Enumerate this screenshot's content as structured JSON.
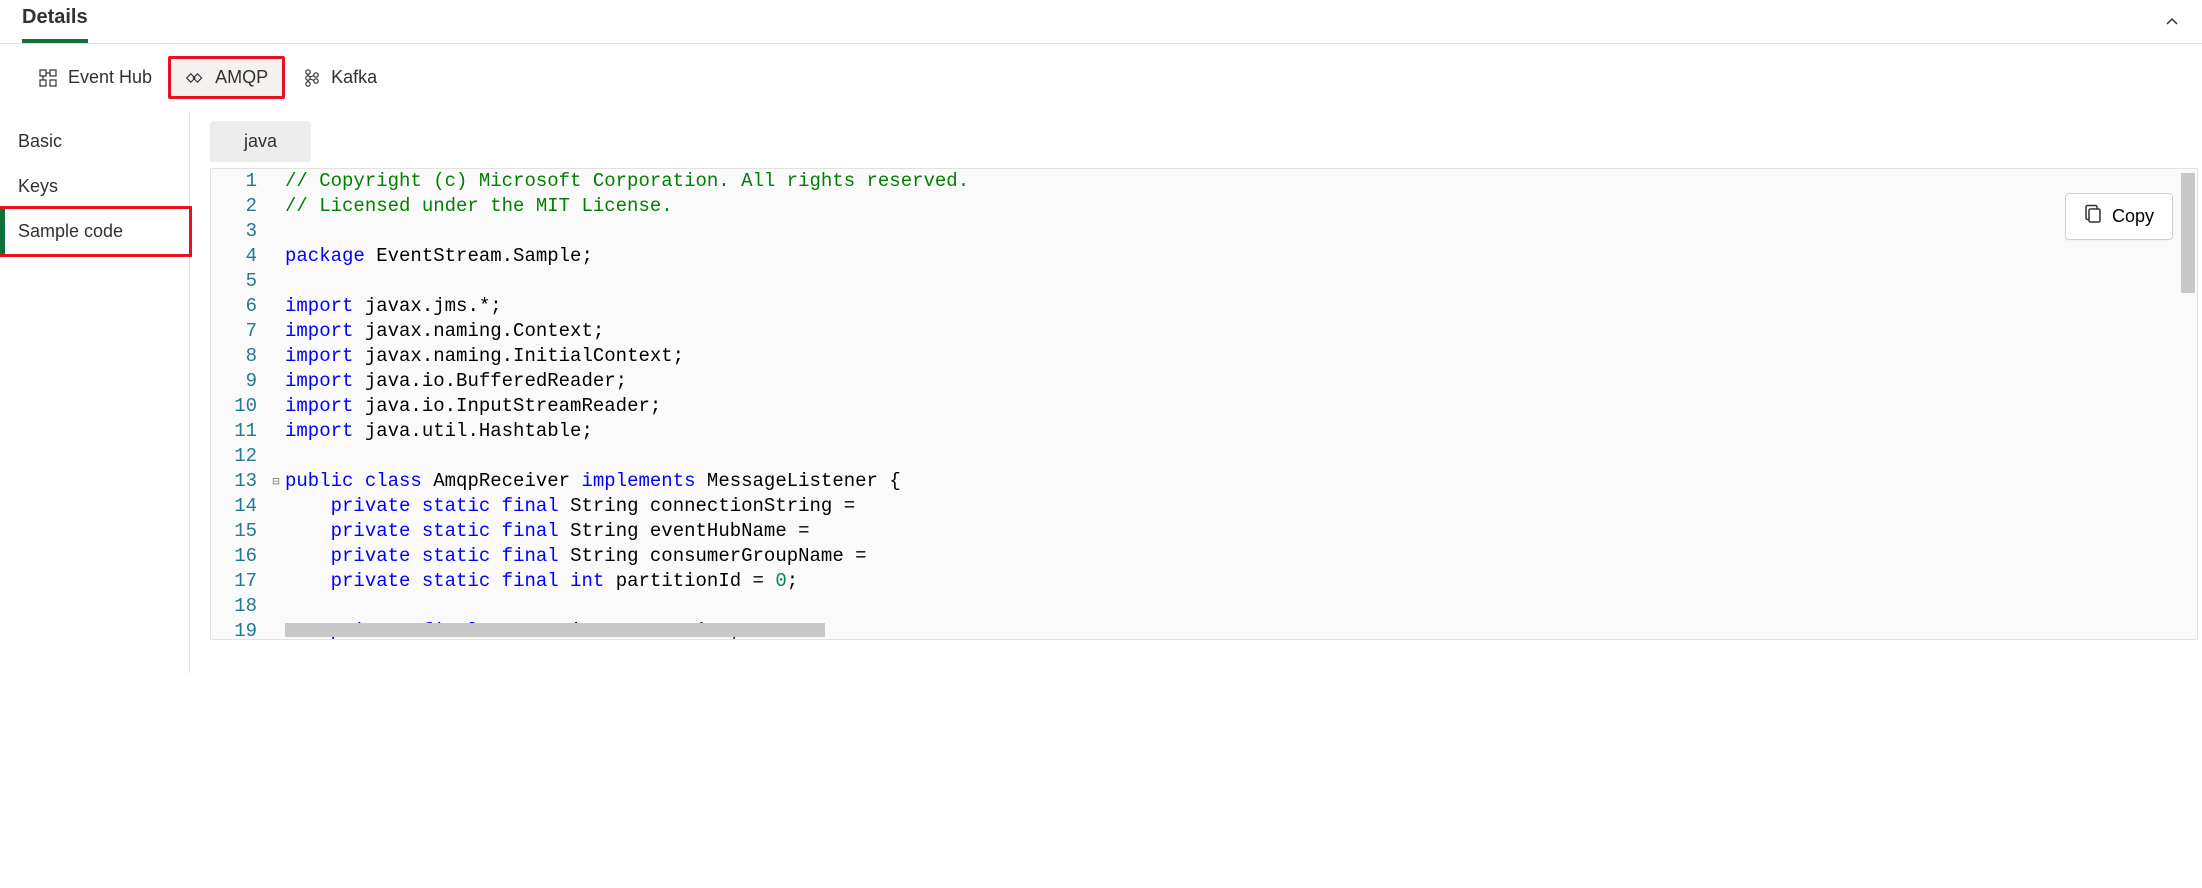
{
  "header": {
    "title": "Details"
  },
  "protocol_tabs": [
    {
      "label": "Event Hub",
      "icon": "eventhub"
    },
    {
      "label": "AMQP",
      "icon": "amqp"
    },
    {
      "label": "Kafka",
      "icon": "kafka"
    }
  ],
  "sidebar": {
    "items": [
      {
        "label": "Basic"
      },
      {
        "label": "Keys"
      },
      {
        "label": "Sample code"
      }
    ]
  },
  "lang_tab": {
    "label": "java"
  },
  "copy_button": {
    "label": "Copy"
  },
  "code_lines": [
    {
      "n": 1,
      "fold": "",
      "tokens": [
        [
          "comment",
          "// Copyright (c) Microsoft Corporation. All rights reserved."
        ]
      ]
    },
    {
      "n": 2,
      "fold": "",
      "tokens": [
        [
          "comment",
          "// Licensed under the MIT License."
        ]
      ]
    },
    {
      "n": 3,
      "fold": "",
      "tokens": []
    },
    {
      "n": 4,
      "fold": "",
      "tokens": [
        [
          "keyword",
          "package"
        ],
        [
          "plain",
          " EventStream.Sample;"
        ]
      ]
    },
    {
      "n": 5,
      "fold": "",
      "tokens": []
    },
    {
      "n": 6,
      "fold": "",
      "tokens": [
        [
          "keyword",
          "import"
        ],
        [
          "plain",
          " javax.jms.*;"
        ]
      ]
    },
    {
      "n": 7,
      "fold": "",
      "tokens": [
        [
          "keyword",
          "import"
        ],
        [
          "plain",
          " javax.naming.Context;"
        ]
      ]
    },
    {
      "n": 8,
      "fold": "",
      "tokens": [
        [
          "keyword",
          "import"
        ],
        [
          "plain",
          " javax.naming.InitialContext;"
        ]
      ]
    },
    {
      "n": 9,
      "fold": "",
      "tokens": [
        [
          "keyword",
          "import"
        ],
        [
          "plain",
          " java.io.BufferedReader;"
        ]
      ]
    },
    {
      "n": 10,
      "fold": "",
      "tokens": [
        [
          "keyword",
          "import"
        ],
        [
          "plain",
          " java.io.InputStreamReader;"
        ]
      ]
    },
    {
      "n": 11,
      "fold": "",
      "tokens": [
        [
          "keyword",
          "import"
        ],
        [
          "plain",
          " java.util.Hashtable;"
        ]
      ]
    },
    {
      "n": 12,
      "fold": "",
      "tokens": []
    },
    {
      "n": 13,
      "fold": "⊟",
      "tokens": [
        [
          "keyword",
          "public"
        ],
        [
          "plain",
          " "
        ],
        [
          "keyword",
          "class"
        ],
        [
          "plain",
          " AmqpReceiver "
        ],
        [
          "keyword",
          "implements"
        ],
        [
          "plain",
          " MessageListener {"
        ]
      ]
    },
    {
      "n": 14,
      "fold": "",
      "tokens": [
        [
          "plain",
          "    "
        ],
        [
          "keyword",
          "private"
        ],
        [
          "plain",
          " "
        ],
        [
          "keyword",
          "static"
        ],
        [
          "plain",
          " "
        ],
        [
          "keyword",
          "final"
        ],
        [
          "plain",
          " String connectionString ="
        ]
      ]
    },
    {
      "n": 15,
      "fold": "",
      "tokens": [
        [
          "plain",
          "    "
        ],
        [
          "keyword",
          "private"
        ],
        [
          "plain",
          " "
        ],
        [
          "keyword",
          "static"
        ],
        [
          "plain",
          " "
        ],
        [
          "keyword",
          "final"
        ],
        [
          "plain",
          " String eventHubName ="
        ]
      ]
    },
    {
      "n": 16,
      "fold": "",
      "tokens": [
        [
          "plain",
          "    "
        ],
        [
          "keyword",
          "private"
        ],
        [
          "plain",
          " "
        ],
        [
          "keyword",
          "static"
        ],
        [
          "plain",
          " "
        ],
        [
          "keyword",
          "final"
        ],
        [
          "plain",
          " String consumerGroupName ="
        ]
      ]
    },
    {
      "n": 17,
      "fold": "",
      "tokens": [
        [
          "plain",
          "    "
        ],
        [
          "keyword",
          "private"
        ],
        [
          "plain",
          " "
        ],
        [
          "keyword",
          "static"
        ],
        [
          "plain",
          " "
        ],
        [
          "keyword",
          "final"
        ],
        [
          "plain",
          " "
        ],
        [
          "keyword",
          "int"
        ],
        [
          "plain",
          " partitionId = "
        ],
        [
          "num",
          "0"
        ],
        [
          "plain",
          ";"
        ]
      ]
    },
    {
      "n": 18,
      "fold": "",
      "tokens": []
    },
    {
      "n": 19,
      "fold": "",
      "tokens": [
        [
          "plain",
          "    "
        ],
        [
          "keyword",
          "private"
        ],
        [
          "plain",
          " "
        ],
        [
          "keyword",
          "final"
        ],
        [
          "plain",
          " Connection connection;"
        ]
      ]
    }
  ]
}
